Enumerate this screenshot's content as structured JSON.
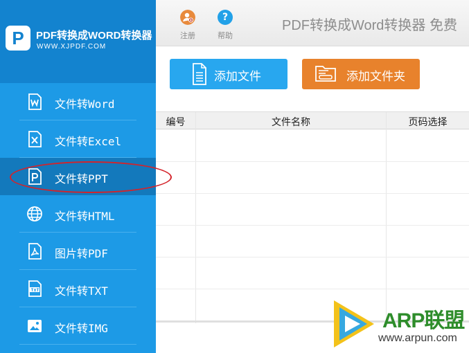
{
  "brand": {
    "logo_letter": "P",
    "name": "PDF转换成WORD转换器",
    "url": "WWW.XJPDF.COM"
  },
  "sidebar": {
    "items": [
      {
        "label": "文件转Word",
        "icon": "word-file-icon",
        "active": false
      },
      {
        "label": "文件转Excel",
        "icon": "excel-file-icon",
        "active": false
      },
      {
        "label": "文件转PPT",
        "icon": "ppt-file-icon",
        "active": true
      },
      {
        "label": "文件转HTML",
        "icon": "globe-icon",
        "active": false
      },
      {
        "label": "图片转PDF",
        "icon": "pdf-file-icon",
        "active": false
      },
      {
        "label": "文件转TXT",
        "icon": "txt-file-icon",
        "active": false
      },
      {
        "label": "文件转IMG",
        "icon": "image-icon",
        "active": false
      }
    ]
  },
  "toolbar": {
    "register_label": "注册",
    "help_label": "帮助",
    "help_symbol": "?",
    "app_title": "PDF转换成Word转换器 免费"
  },
  "actions": {
    "add_file_label": "添加文件",
    "add_folder_label": "添加文件夹"
  },
  "table": {
    "columns": [
      "编号",
      "文件名称",
      "页码选择"
    ],
    "rows": []
  },
  "watermark": {
    "brand": "ARP联盟",
    "site": "www.arpun.com"
  },
  "colors": {
    "sidebar": "#1d9ae6",
    "sidebar_active": "#1379bc",
    "add_file_button": "#28a7ef",
    "add_folder_button": "#e8822c",
    "highlight_circle": "#d4232a"
  }
}
